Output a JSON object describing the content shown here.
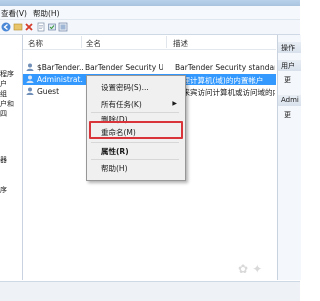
{
  "menubar": {
    "items": [
      {
        "label": "查看(V)"
      },
      {
        "label": "帮助(H)"
      }
    ]
  },
  "toolbar": {
    "icons": [
      "back-arrow-icon",
      "forward-arrow-icon",
      "folder-icon",
      "close-icon",
      "document-icon",
      "help-icon",
      "console-icon"
    ]
  },
  "tree": {
    "items": [
      "程序",
      "户",
      "组",
      "户和",
      "四",
      "",
      "",
      "",
      "器",
      "",
      "",
      "序",
      ""
    ]
  },
  "list": {
    "columns": [
      "名称",
      "全名",
      "描述"
    ],
    "rows": [
      {
        "name": "$BarTender...",
        "full": "BarTender Security Us...",
        "desc": "BarTender Security standard u..."
      },
      {
        "name": "Administrat...",
        "full": "",
        "desc": "管理计算机(域)的内置帐户",
        "selected": true
      },
      {
        "name": "Guest",
        "full": "",
        "desc": "供来宾访问计算机或访问域的内..."
      }
    ]
  },
  "context_menu": {
    "items": [
      {
        "label": "设置密码(S)..."
      },
      {
        "label": "所有任务(K)",
        "submenu": true
      },
      {
        "label": "删除(D)"
      },
      {
        "label": "重命名(M)",
        "highlighted": true
      },
      {
        "label": "属性(R)",
        "bold": true
      },
      {
        "label": "帮助(H)"
      }
    ]
  },
  "action_pane": {
    "headers": [
      "操作",
      "用户",
      "Admi"
    ],
    "items": [
      "更",
      "更"
    ]
  },
  "colors": {
    "selection": "#3399ff",
    "highlight_box": "#d9343a"
  }
}
